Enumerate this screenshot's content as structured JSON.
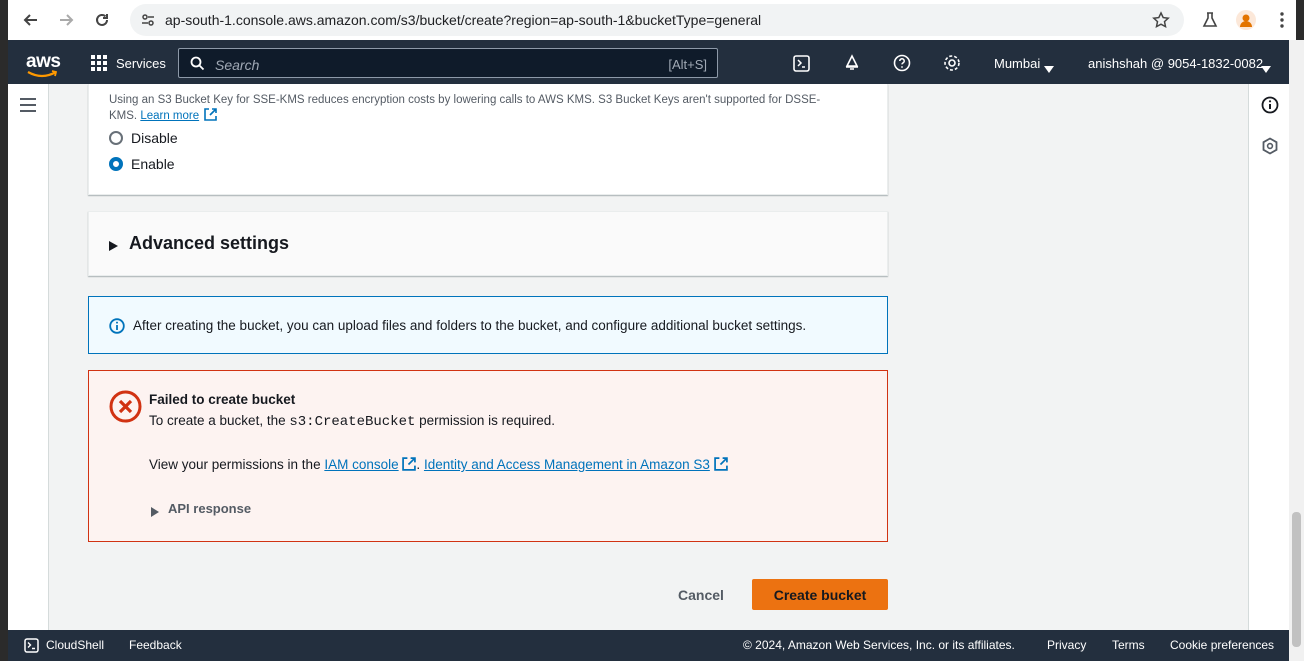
{
  "browser": {
    "url": "ap-south-1.console.aws.amazon.com/s3/bucket/create?region=ap-south-1&bucketType=general"
  },
  "nav": {
    "logo": "aws",
    "services_label": "Services",
    "search_placeholder": "Search",
    "search_shortcut": "[Alt+S]",
    "region": "Mumbai",
    "account": "anishshah @ 9054-1832-0082"
  },
  "bucket_key": {
    "description": "Using an S3 Bucket Key for SSE-KMS reduces encryption costs by lowering calls to AWS KMS. S3 Bucket Keys aren't supported for DSSE-",
    "description_cont": "KMS.",
    "learn_more": "Learn more",
    "options": [
      {
        "label": "Disable",
        "selected": false
      },
      {
        "label": "Enable",
        "selected": true
      }
    ]
  },
  "advanced": {
    "title": "Advanced settings"
  },
  "info_alert": {
    "text": "After creating the bucket, you can upload files and folders to the bucket, and configure additional bucket settings."
  },
  "error_alert": {
    "title": "Failed to create bucket",
    "line1_pre": "To create a bucket, the",
    "line1_code": "s3:CreateBucket",
    "line1_post": "permission is required.",
    "line2_pre": "View your permissions in the",
    "iam_link": "IAM console",
    "sep": ".",
    "iam_s3_link": "Identity and Access Management in Amazon S3",
    "api_response": "API response"
  },
  "actions": {
    "cancel": "Cancel",
    "create": "Create bucket"
  },
  "footer": {
    "cloudshell": "CloudShell",
    "feedback": "Feedback",
    "copyright": "© 2024, Amazon Web Services, Inc. or its affiliates.",
    "privacy": "Privacy",
    "terms": "Terms",
    "cookies": "Cookie preferences"
  },
  "colors": {
    "primary": "#ec7211",
    "link": "#0073bb",
    "error": "#d13212",
    "info_bg": "#f1faff",
    "error_bg": "#fdf3f1"
  }
}
